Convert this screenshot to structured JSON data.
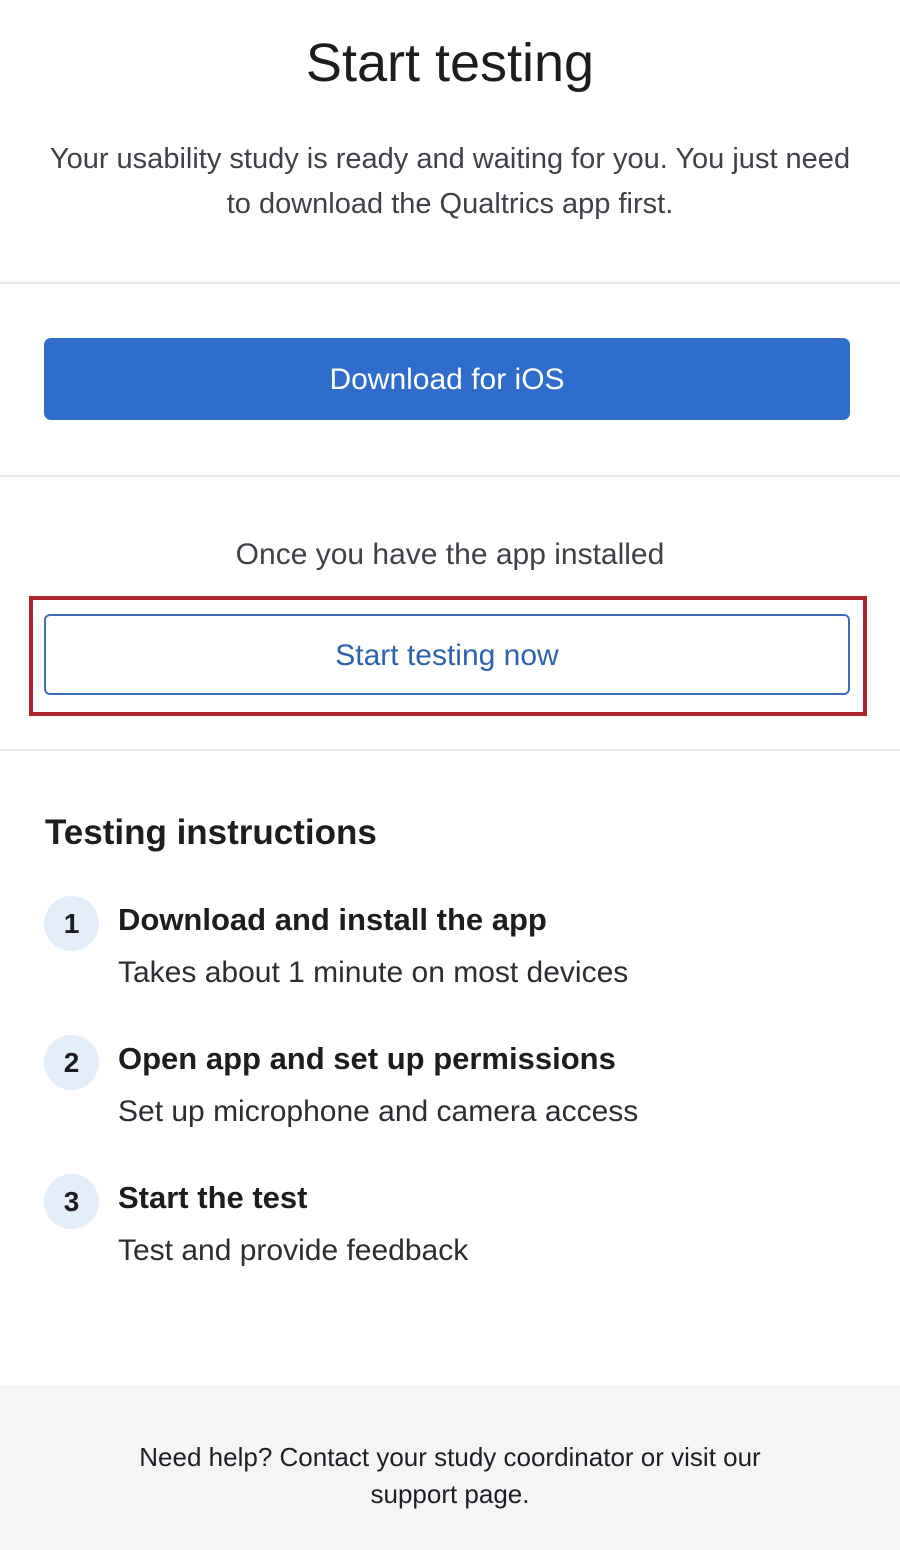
{
  "header": {
    "title": "Start testing",
    "subtitle": "Your usability study is ready and waiting for you. You just need to download the Qualtrics app first."
  },
  "download": {
    "button_label": "Download for iOS"
  },
  "start": {
    "prompt": "Once you have the app installed",
    "button_label": "Start testing now"
  },
  "instructions": {
    "heading": "Testing instructions",
    "steps": [
      {
        "number": "1",
        "title": "Download and install the app",
        "description": "Takes about 1 minute on most devices"
      },
      {
        "number": "2",
        "title": "Open app and set up permissions",
        "description": "Set up microphone and camera access"
      },
      {
        "number": "3",
        "title": "Start the test",
        "description": "Test and provide feedback"
      }
    ]
  },
  "footer": {
    "help_text": "Need help? Contact your study coordinator or visit our",
    "link_text": "support page."
  },
  "colors": {
    "primary_button": "#2f6dcc",
    "secondary_button_border": "#3d6fb8",
    "highlight_frame": "#b0252b",
    "step_badge": "#e3eef9",
    "footer_background": "#f4f5f7"
  }
}
